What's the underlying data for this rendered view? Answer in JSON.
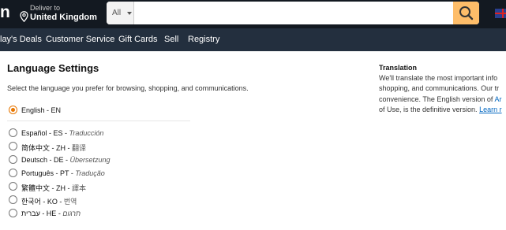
{
  "header": {
    "logo_fragment": "n",
    "deliver_to_label": "Deliver to",
    "deliver_to_location": "United Kingdom",
    "search_category": "All",
    "search_value": "",
    "search_placeholder": "",
    "search_icon": "search-icon",
    "flag_icon": "uk-flag-icon"
  },
  "nav": {
    "items": [
      "lay's Deals",
      "Customer Service",
      "Gift Cards",
      "Sell",
      "Registry"
    ]
  },
  "language_settings": {
    "title": "Language Settings",
    "description": "Select the language you prefer for browsing, shopping, and communications.",
    "selected": "English - EN",
    "options": [
      {
        "label": "English - EN",
        "translation": "",
        "checked": true
      },
      {
        "label": "Español - ES - ",
        "translation": "Traducción",
        "checked": false
      },
      {
        "label": "简体中文 - ZH - ",
        "translation": "翻译",
        "checked": false
      },
      {
        "label": "Deutsch - DE - ",
        "translation": "Übersetzung",
        "checked": false
      },
      {
        "label": "Português - PT - ",
        "translation": "Tradução",
        "checked": false
      },
      {
        "label": "繁體中文 - ZH - ",
        "translation": "譯本",
        "checked": false
      },
      {
        "label": "한국어 - KO - ",
        "translation": "번역",
        "checked": false
      },
      {
        "label": "עברית - HE - ",
        "translation": "תרגום",
        "checked": false
      }
    ]
  },
  "translation": {
    "title": "Translation",
    "line1": "We'll translate the most important info",
    "line2": "shopping, and communications. Our tr",
    "line3_prefix": "convenience. The English version of ",
    "line3_link": "Ar",
    "line4_prefix": "of Use, is the definitive version. ",
    "line4_link": "Learn r"
  },
  "colors": {
    "topbar": "#131921",
    "navbar": "#232f3e",
    "search_button": "#febd69",
    "radio_selected": "#e77600",
    "link": "#0066c0"
  }
}
